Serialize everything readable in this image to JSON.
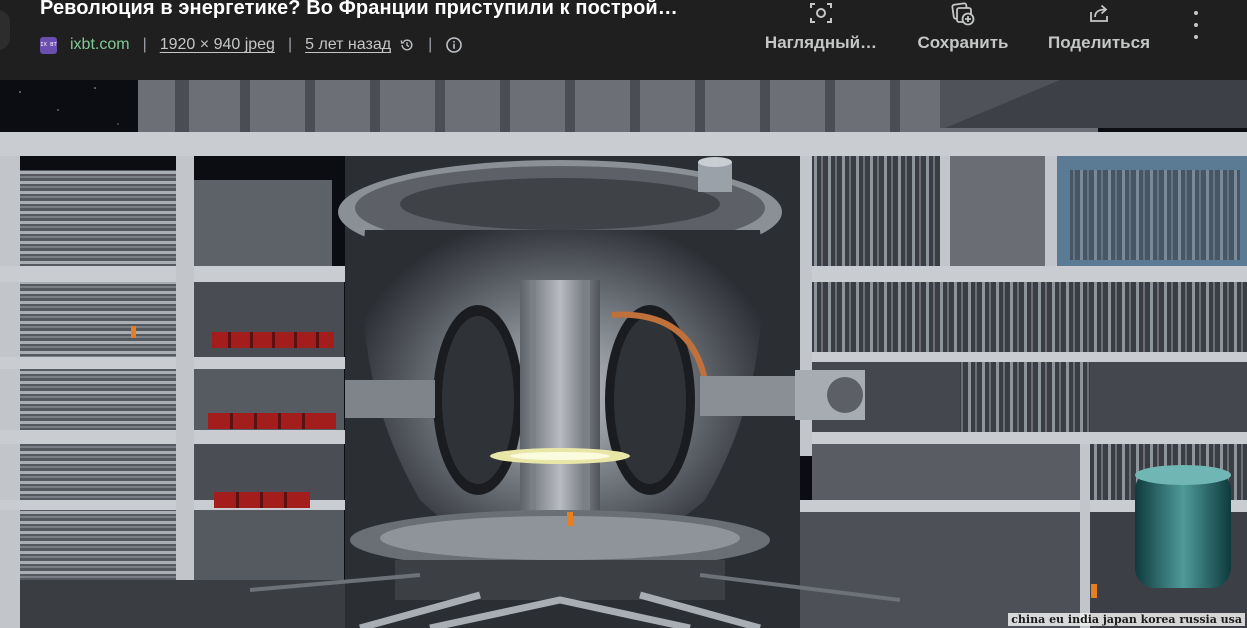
{
  "header": {
    "title": "Революция в энергетике? Во Франции приступили к построй…",
    "favicon_text": "IX BT",
    "source": "ixbt.com",
    "separator": "|",
    "dimensions": "1920 × 940 jpeg",
    "age": "5 лет назад",
    "actions": {
      "visual_label": "Наглядный…",
      "save_label": "Сохранить",
      "share_label": "Поделиться"
    }
  },
  "image": {
    "alt_description_icon": "history-icon",
    "caption": "china eu india japan korea russia usa"
  },
  "colors": {
    "background": "#1f1f1f",
    "source_green": "#81c995",
    "text_muted": "#bdc1c6",
    "title": "#ffffff",
    "favicon": "#6a4fb0"
  }
}
